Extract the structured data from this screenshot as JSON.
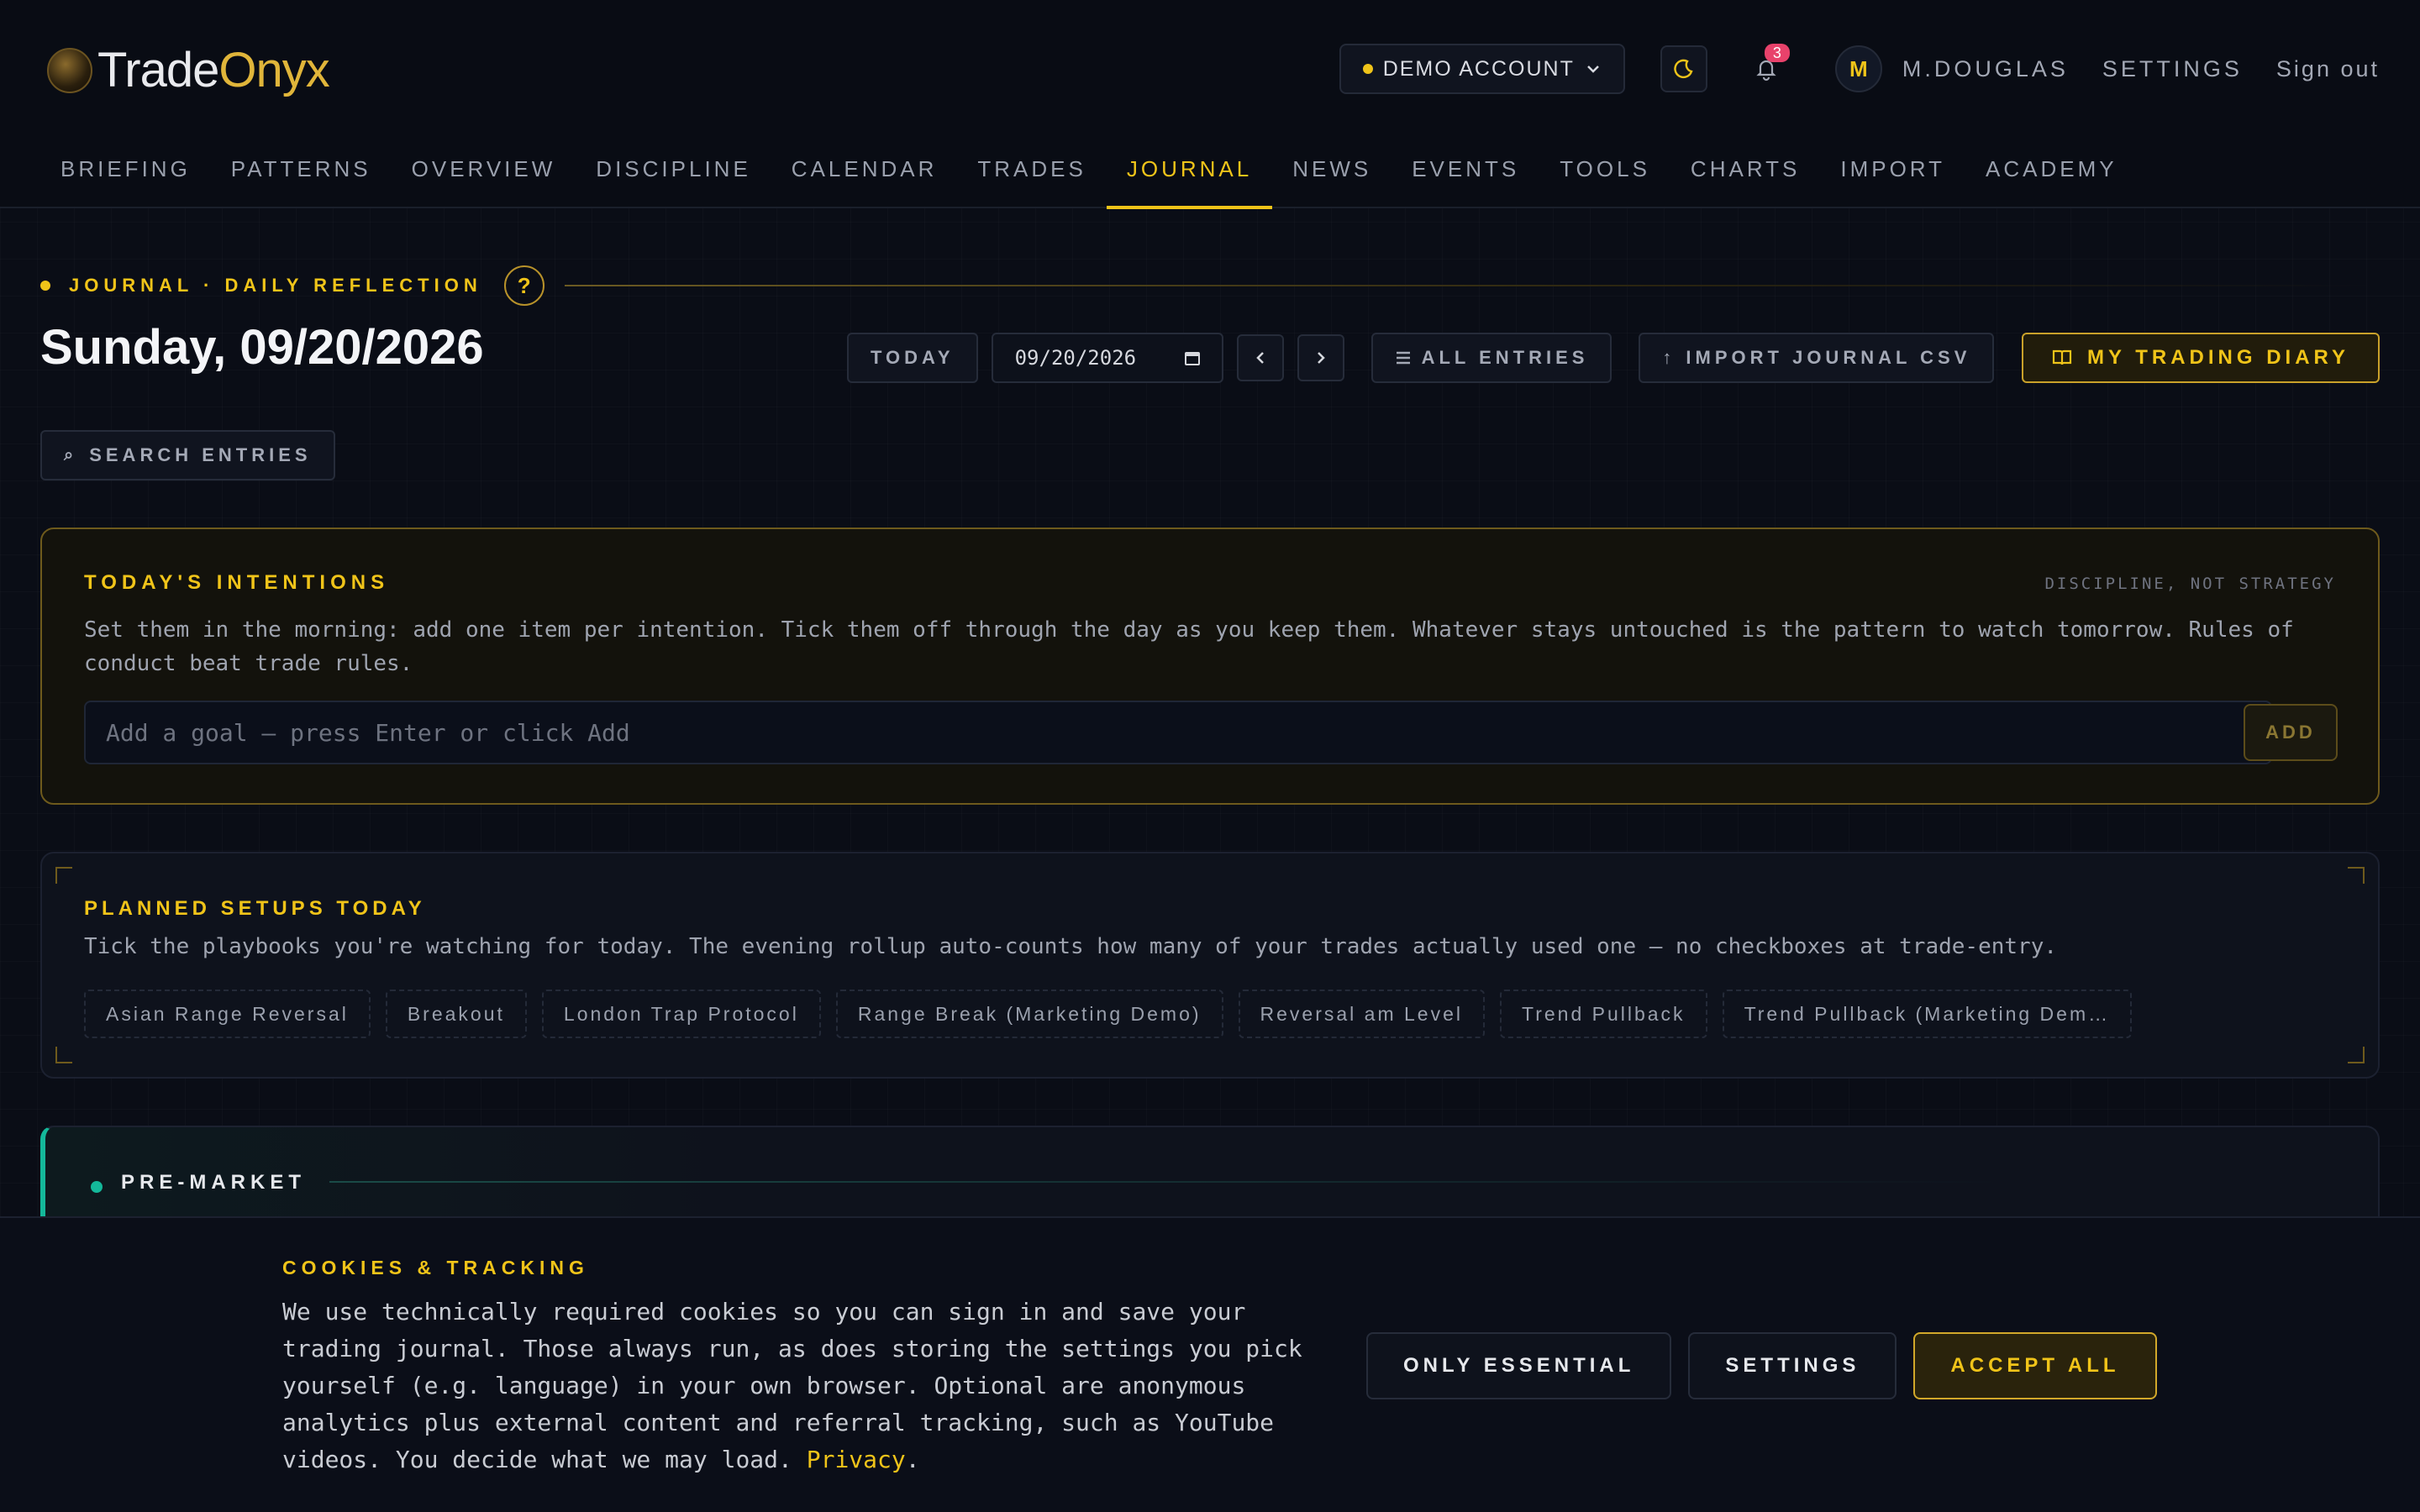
{
  "brand": {
    "name_a": "Trade",
    "name_b": "Onyx"
  },
  "header": {
    "account": "DEMO ACCOUNT",
    "notifications": "3",
    "avatar": "M",
    "user": "M.DOUGLAS",
    "settings": "SETTINGS",
    "signout": "Sign out"
  },
  "nav": [
    "BRIEFING",
    "PATTERNS",
    "OVERVIEW",
    "DISCIPLINE",
    "CALENDAR",
    "TRADES",
    "JOURNAL",
    "NEWS",
    "EVENTS",
    "TOOLS",
    "CHARTS",
    "IMPORT",
    "ACADEMY"
  ],
  "nav_active": "JOURNAL",
  "page": {
    "crumb": "JOURNAL · DAILY REFLECTION",
    "help": "?",
    "title": "Sunday, 09/20/2026",
    "today": "TODAY",
    "date": "09/20/2026",
    "all_entries": "ALL ENTRIES",
    "import_csv": "IMPORT JOURNAL CSV",
    "diary": "MY TRADING DIARY",
    "search": "SEARCH ENTRIES"
  },
  "intentions": {
    "title": "TODAY'S INTENTIONS",
    "tag": "DISCIPLINE, NOT STRATEGY",
    "description": "Set them in the morning: add one item per intention. Tick them off through the day as you keep them. Whatever stays untouched is the pattern to watch tomorrow. Rules of conduct beat trade rules.",
    "placeholder": "Add a goal — press Enter or click Add",
    "add": "ADD"
  },
  "setups": {
    "title": "PLANNED SETUPS TODAY",
    "description": "Tick the playbooks you're watching for today. The evening rollup auto-counts how many of your trades actually used one — no checkboxes at trade-entry.",
    "chips": [
      "Asian Range Reversal",
      "Breakout",
      "London Trap Protocol",
      "Range Break (Marketing Demo)",
      "Reversal am Level",
      "Trend Pullback",
      "Trend Pullback (Marketing Dem…"
    ]
  },
  "premarket": {
    "title": "PRE-MARKET"
  },
  "cookie": {
    "title": "COOKIES & TRACKING",
    "text": "We use technically required cookies so you can sign in and save your trading journal. Those always run, as does storing the settings you pick yourself (e.g. language) in your own browser. Optional are anonymous analytics plus external content and referral tracking, such as YouTube videos. You decide what we may load.",
    "privacy": "Privacy",
    "essential": "ONLY ESSENTIAL",
    "settings": "SETTINGS",
    "accept": "ACCEPT ALL"
  },
  "colors": {
    "accent": "#f0c419",
    "teal": "#14b89a",
    "bg": "#0a0d16",
    "badge": "#e8426b"
  },
  "icons": [
    "logo-icon",
    "chevron-down-icon",
    "moon-icon",
    "bell-icon",
    "calendar-icon",
    "chevron-left-icon",
    "chevron-right-icon",
    "list-icon",
    "upload-icon",
    "book-icon",
    "search-icon"
  ]
}
